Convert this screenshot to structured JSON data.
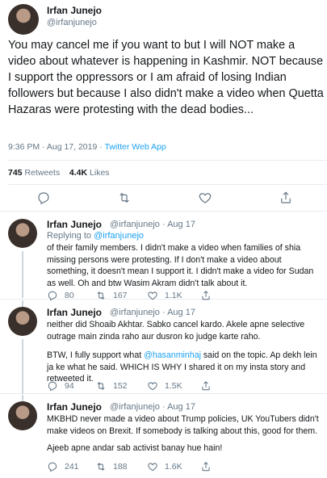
{
  "main_tweet": {
    "name": "Irfan Junejo",
    "handle": "@irfanjunejo",
    "text": "You may cancel me if you want to but I will NOT make a video about whatever is happening in Kashmir. NOT because I support the oppressors or I am afraid of losing Indian followers but because I also didn't make a video when Quetta Hazaras were protesting with the dead bodies...",
    "time": "9:36 PM · Aug 17, 2019 · ",
    "app": "Twitter Web App",
    "retweets_count": "745",
    "retweets_label": "Retweets",
    "likes_count": "4.4K",
    "likes_label": "Likes"
  },
  "replies": [
    {
      "name": "Irfan Junejo",
      "handle": "@irfanjunejo · Aug 17",
      "replying_prefix": "Replying to ",
      "replying_to": "@irfanjunejo",
      "text": "of their family members. I didn't make a video when families of shia missing persons were protesting. If I don't make a video about something, it doesn't mean I support it. I didn't make a video for Sudan as well. Oh and btw Wasim Akram didn't talk about it.",
      "replies": "80",
      "retweets": "167",
      "likes": "1.1K"
    },
    {
      "name": "Irfan Junejo",
      "handle": "@irfanjunejo · Aug 17",
      "text1": "neither did Shoaib Akhtar. Sabko cancel kardo. Akele apne selective outrage main zinda raho aur dusron ko judge karte raho.",
      "text2_a": "BTW, I fully support what ",
      "text2_mention": "@hasanminhaj",
      "text2_b": " said on the topic. Ap dekh lein ja ke what he said. WHICH IS WHY I shared it on my insta story and retweeted it.",
      "replies": "94",
      "retweets": "152",
      "likes": "1.5K"
    },
    {
      "name": "Irfan Junejo",
      "handle": "@irfanjunejo · Aug 17",
      "text1": "MKBHD never made a video about Trump policies, UK YouTubers didn't make videos on Brexit. If somebody is talking about this, good for them.",
      "text2": "Ajeeb apne andar sab activist banay hue hain!",
      "replies": "241",
      "retweets": "188",
      "likes": "1.6K"
    }
  ],
  "icons": [
    "reply-icon",
    "retweet-icon",
    "like-icon",
    "share-icon"
  ],
  "colors": {
    "text": "#14171a",
    "secondary": "#657786",
    "link": "#1da1f2",
    "border": "#e6ecf0"
  }
}
